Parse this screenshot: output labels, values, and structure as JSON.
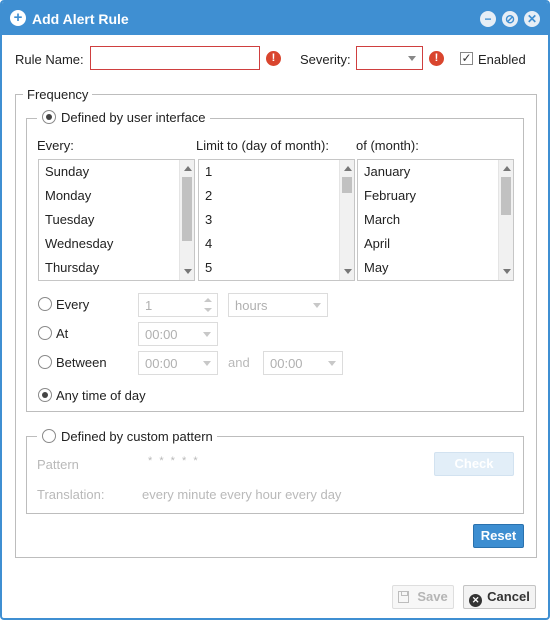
{
  "dialog": {
    "title": "Add Alert Rule",
    "title_icon": "plus-circle-icon",
    "buttons": [
      "minimize-icon",
      "restore-icon",
      "close-icon"
    ]
  },
  "rule": {
    "name_label": "Rule Name:",
    "name_value": "",
    "severity_label": "Severity:",
    "severity_value": "",
    "enabled_label": "Enabled",
    "enabled_checked": true,
    "validation_icon": "!"
  },
  "frequency": {
    "legend": "Frequency",
    "ui_option": {
      "label": "Defined by user interface",
      "selected": true,
      "every_header": "Every:",
      "limit_header": "Limit to (day of month):",
      "month_header": "of (month):",
      "days": [
        "Sunday",
        "Monday",
        "Tuesday",
        "Wednesday",
        "Thursday"
      ],
      "day_numbers": [
        "1",
        "2",
        "3",
        "4",
        "5"
      ],
      "months": [
        "January",
        "February",
        "March",
        "April",
        "May"
      ],
      "every": {
        "label": "Every",
        "value": "1",
        "unit": "hours"
      },
      "at": {
        "label": "At",
        "value": "00:00"
      },
      "between": {
        "label": "Between",
        "from": "00:00",
        "and_label": "and",
        "to": "00:00"
      },
      "any_time": {
        "label": "Any time of day",
        "selected": true
      }
    },
    "custom_option": {
      "label": "Defined by custom pattern",
      "selected": false,
      "pattern_label": "Pattern",
      "pattern_value": "* * * * *",
      "check_label": "Check",
      "translation_label": "Translation:",
      "translation_value": "every minute every hour every day"
    },
    "reset_label": "Reset"
  },
  "footer": {
    "save_label": "Save",
    "cancel_label": "Cancel",
    "cancel_icon": "✕"
  }
}
